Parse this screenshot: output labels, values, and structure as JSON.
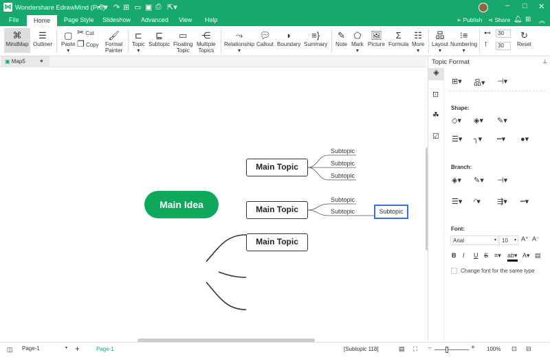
{
  "app": {
    "title": "Wondershare EdrawMind (Pro)",
    "brand_color": "#17a86e"
  },
  "topbar": {
    "publish": "Publish",
    "share": "Share"
  },
  "menu": [
    "File",
    "Home",
    "Page Style",
    "Slideshow",
    "Advanced",
    "View",
    "Help"
  ],
  "ribbon": {
    "mindmap": "MindMap",
    "outliner": "Outliner",
    "paste": "Paste",
    "cut": "Cut",
    "copy": "Copy",
    "format_painter": [
      "Format",
      "Painter"
    ],
    "topic": "Topic",
    "subtopic": "Subtopic",
    "floating_topic": [
      "Floating",
      "Topic"
    ],
    "multiple_topics": [
      "Multiple",
      "Topics"
    ],
    "relationship": "Relationship",
    "callout": "Callout",
    "boundary": "Boundary",
    "summary": "Summary",
    "note": "Note",
    "mark": "Mark",
    "picture": "Picture",
    "formula": "Formula",
    "more": "More",
    "layout": "Layout",
    "numbering": "Numbering",
    "spacing_h": "30",
    "spacing_v": "30",
    "reset": "Reset"
  },
  "doc_tab": {
    "name": "Map5"
  },
  "mindmap": {
    "main_idea": "Main Idea",
    "main_color": "#0fa95b",
    "topics": [
      "Main Topic",
      "Main Topic",
      "Main Topic"
    ],
    "subtopics_1": [
      "Subtopic",
      "Subtopic",
      "Subtopic"
    ],
    "subtopics_2": [
      "Subtopic",
      "Subtopic"
    ],
    "selected_subtopic": "Subtopic",
    "selection_color": "#3a6fd8"
  },
  "panel": {
    "title": "Topic Format",
    "shape_label": "Shape:",
    "branch_label": "Branch:",
    "font_label": "Font:",
    "font_family": "Arial",
    "font_size": "10",
    "same_type": "Change font for the same type"
  },
  "status": {
    "page_select": "Page-1",
    "page_tab": "Page-1",
    "selection": "[Subtopic 118]",
    "zoom": "100%"
  }
}
